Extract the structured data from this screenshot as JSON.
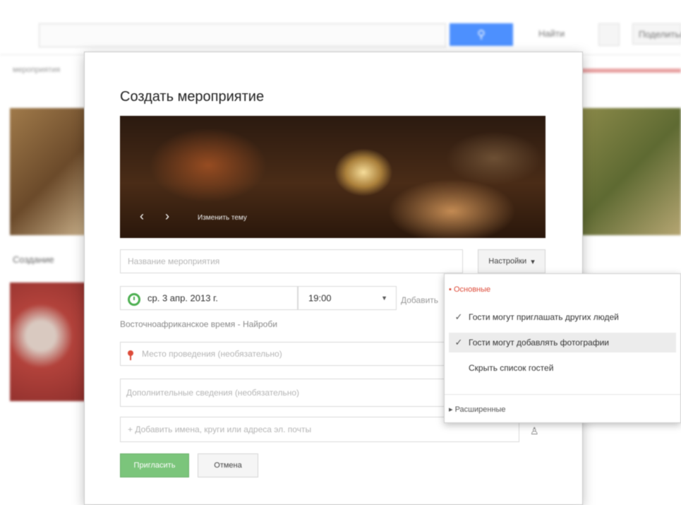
{
  "dialog": {
    "title": "Создать мероприятие",
    "photo_change_label": "Изменить тему",
    "event_name_placeholder": "Название мероприятия",
    "settings_button_label": "Настройки",
    "date_value": "ср. 3 апр. 2013 г.",
    "time_value": "19:00",
    "add_end_time_link": "Добавить",
    "timezone_text": "Восточноафриканское время - Найроби",
    "location_placeholder": "Место проведения (необязательно)",
    "details_placeholder": "Дополнительные сведения (необязательно)",
    "guests_placeholder": "+ Добавить имена, круги или адреса эл. почты",
    "invite_button_label": "Пригласить",
    "cancel_button_label": "Отмена"
  },
  "settings_menu": {
    "basic_section": "▪ Основные",
    "items": [
      {
        "label": "Гости могут приглашать других людей",
        "checked": true
      },
      {
        "label": "Гости могут добавлять фотографии",
        "checked": true
      },
      {
        "label": "Скрыть список гостей",
        "checked": false
      }
    ],
    "advanced_section": "▸ Расширенные"
  },
  "background": {
    "top_links": [
      "Найти",
      "Поделиться"
    ],
    "subtitle": "мероприятия",
    "tile_caption": "Создание"
  },
  "icons": {
    "search": "search-icon",
    "prev": "chevron-left-icon",
    "next": "chevron-right-icon",
    "clock": "clock-icon",
    "pin": "location-pin-icon",
    "person": "add-person-icon",
    "check": "checkmark-icon"
  },
  "colors": {
    "accent_blue": "#4d90fe",
    "invite_green": "#7bc57b",
    "menu_red": "#dd4b39",
    "clock_green": "#4caf50"
  }
}
